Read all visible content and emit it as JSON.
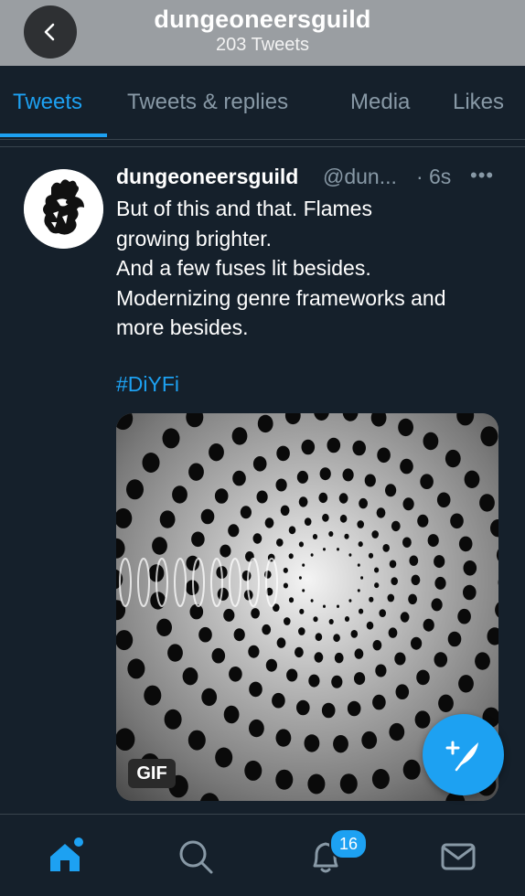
{
  "header": {
    "title": "dungeoneersguild",
    "subtitle": "203 Tweets",
    "back_icon": "chevron-left-icon"
  },
  "tabs": [
    {
      "label": "Tweets",
      "active": true
    },
    {
      "label": "Tweets & replies",
      "active": false
    },
    {
      "label": "Media",
      "active": false
    },
    {
      "label": "Likes",
      "active": false
    }
  ],
  "tweet": {
    "name": "dungeoneersguild",
    "handle": "@dun...",
    "separator": "·",
    "time": "6s",
    "more": "•••",
    "lines": [
      "But of this and that. Flames",
      "growing brighter.",
      "And a few fuses lit besides.",
      "Modernizing genre frameworks and",
      "more besides."
    ],
    "hashtag": "#DiYFi",
    "media_badge": "GIF"
  },
  "fab": {
    "icon": "compose-tweet-icon"
  },
  "bottom_nav": {
    "items": [
      "home-icon",
      "search-icon",
      "notifications-icon",
      "messages-icon"
    ],
    "notification_count": "16"
  },
  "colors": {
    "background": "#15202b",
    "accent": "#1da1f2",
    "muted": "#8899a6",
    "header_bg": "#9a9ea2"
  }
}
